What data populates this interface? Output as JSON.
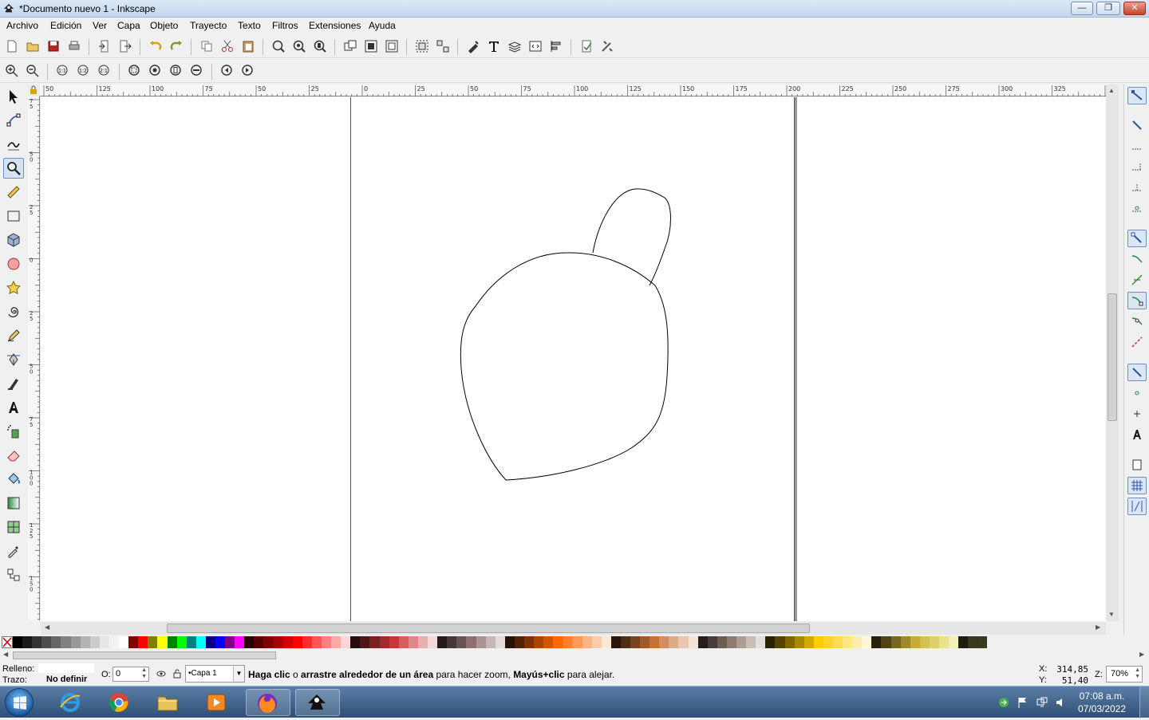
{
  "window": {
    "title": "*Documento nuevo 1 - Inkscape",
    "controls": {
      "minimize": "—",
      "maximize": "❐",
      "close": "✕"
    }
  },
  "menu": [
    "Archivo",
    "Edición",
    "Ver",
    "Capa",
    "Objeto",
    "Trayecto",
    "Texto",
    "Filtros",
    "Extensiones",
    "Ayuda"
  ],
  "hruler": {
    "labels": [
      "50",
      "125",
      "100",
      "75",
      "50",
      "25",
      "0",
      "25",
      "50",
      "75",
      "100",
      "125",
      "150",
      "175",
      "200",
      "225",
      "250",
      "275",
      "300",
      "325"
    ]
  },
  "vruler": {
    "labels": [
      "75",
      "50",
      "25",
      "0",
      "25",
      "50",
      "75",
      "100",
      "125",
      "150"
    ]
  },
  "statusbar": {
    "fill_label": "Relleno:",
    "stroke_label": "Trazo:",
    "stroke_value": "No definir",
    "opacity_label": "O:",
    "opacity_value": "0",
    "layer": "•Capa 1",
    "message_part1": "Haga clic",
    "message_part2": " o ",
    "message_part3": "arrastre alrededor de un área",
    "message_part4": " para hacer zoom, ",
    "message_part5": "Mayús+clic",
    "message_part6": " para alejar.",
    "x_label": "X:",
    "x_value": "314,85",
    "y_label": "Y:",
    "y_value": "51,40",
    "zoom_label": "Z:",
    "zoom_value": "70%"
  },
  "clock": {
    "time": "07:08 a.m.",
    "date": "07/03/2022"
  },
  "palette": [
    "#000000",
    "#1a1a1a",
    "#333333",
    "#4d4d4d",
    "#666666",
    "#808080",
    "#999999",
    "#b3b3b3",
    "#cccccc",
    "#e6e6e6",
    "#f2f2f2",
    "#ffffff",
    "#800000",
    "#ff0000",
    "#808000",
    "#ffff00",
    "#008000",
    "#00ff00",
    "#008080",
    "#00ffff",
    "#000080",
    "#0000ff",
    "#800080",
    "#ff00ff",
    "#2b0000",
    "#550000",
    "#800000",
    "#aa0000",
    "#d40000",
    "#ff0000",
    "#ff2a2a",
    "#ff5555",
    "#ff8080",
    "#ffaaaa",
    "#ffd5d5",
    "#280b0b",
    "#501616",
    "#782121",
    "#a02c2c",
    "#c83737",
    "#d35f5f",
    "#de8787",
    "#e9afaf",
    "#f4d7d7",
    "#241c1c",
    "#483737",
    "#6c5353",
    "#916f6f",
    "#ac9393",
    "#c8b7b7",
    "#e3dbdb",
    "#2b1100",
    "#552200",
    "#803300",
    "#aa4400",
    "#d45500",
    "#ff6600",
    "#ff7f2a",
    "#ff9955",
    "#ffb380",
    "#ffccaa",
    "#ffe6d5",
    "#28170b",
    "#502d16",
    "#784421",
    "#a05a2c",
    "#c87137",
    "#d38d5f",
    "#deaa87",
    "#e9c6af",
    "#f4e3d7",
    "#241f1c",
    "#483e37",
    "#6c5d53",
    "#917c6f",
    "#ac9d93",
    "#c8beb7",
    "#e3dedb",
    "#2b2200",
    "#554400",
    "#806600",
    "#aa8800",
    "#d4aa00",
    "#ffcc00",
    "#ffd42a",
    "#ffdd55",
    "#ffe680",
    "#ffeeaa",
    "#fff6d5",
    "#28220b",
    "#504416",
    "#786721",
    "#a0892c",
    "#c8ab37",
    "#d4c050",
    "#dfd06c",
    "#eae189",
    "#f4efb6",
    "#1c1c10",
    "#38381f",
    "#3a3a1e"
  ],
  "taskbar": {
    "apps": [
      "start-button",
      "internet-explorer",
      "chrome",
      "explorer",
      "media",
      "firefox",
      "inkscape"
    ]
  }
}
